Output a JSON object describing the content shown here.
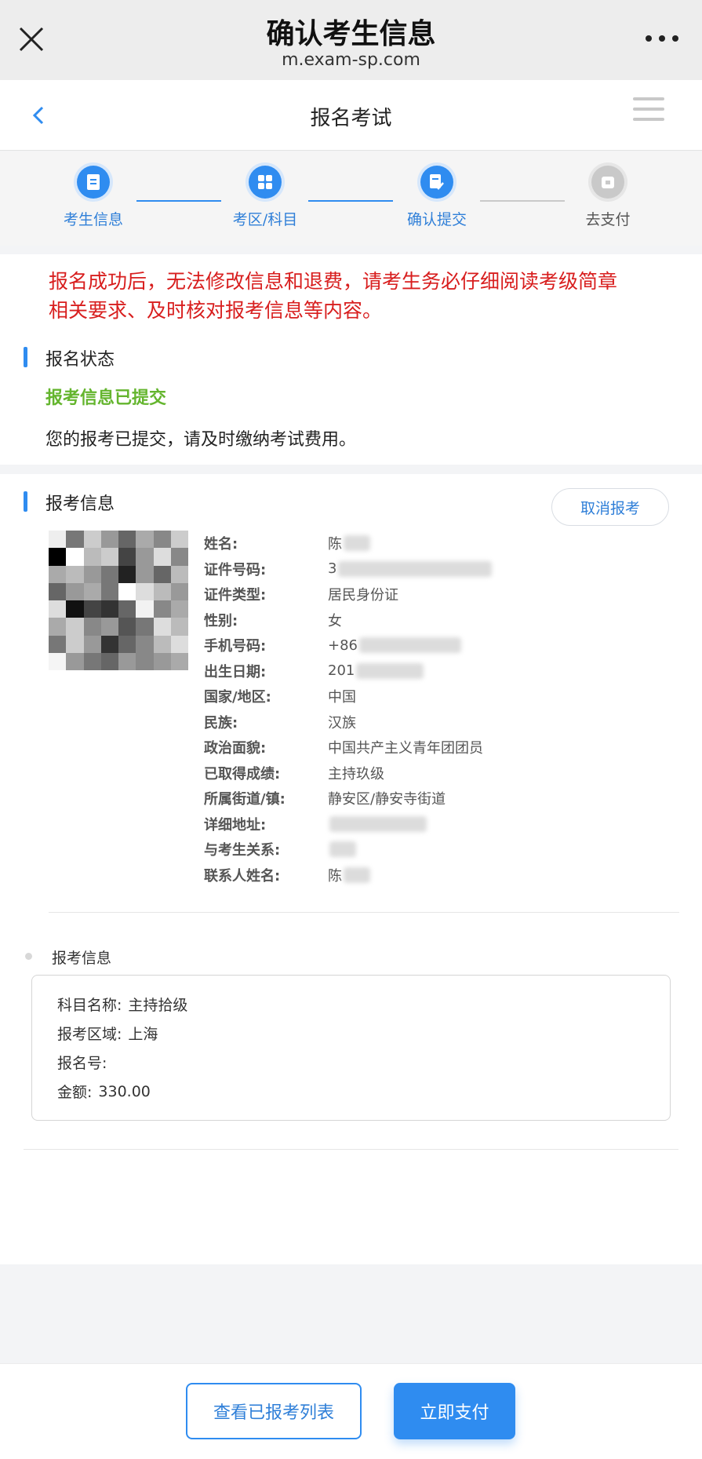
{
  "browser": {
    "title": "确认考生信息",
    "url": "m.exam-sp.com",
    "close_icon": "close-icon",
    "more_icon": "more-icon"
  },
  "nav": {
    "title": "报名考试",
    "back_icon": "chevron-left-icon",
    "menu_icon": "menu-icon"
  },
  "steps": [
    {
      "label": "考生信息",
      "state": "done",
      "icon": "document-icon"
    },
    {
      "label": "考区/科目",
      "state": "done",
      "icon": "grid-icon"
    },
    {
      "label": "确认提交",
      "state": "current",
      "icon": "edit-document-icon"
    },
    {
      "label": "去支付",
      "state": "pending",
      "icon": "wallet-icon"
    }
  ],
  "notice": {
    "warning_line1": "报名成功后，无法修改信息和退费，请考生务必仔细阅读考级简章",
    "warning_line2": "相关要求、及时核对报考信息等内容。"
  },
  "status": {
    "section_title": "报名状态",
    "state": "报考信息已提交",
    "message": "您的报考已提交，请及时缴纳考试费用。"
  },
  "info": {
    "section_title": "报考信息",
    "cancel_label": "取消报考",
    "fields": [
      {
        "label": "姓名:",
        "value": "陈",
        "blurred": true
      },
      {
        "label": "证件号码:",
        "value": "3",
        "blurred": true
      },
      {
        "label": "证件类型:",
        "value": "居民身份证",
        "blurred": false
      },
      {
        "label": "性别:",
        "value": "女",
        "blurred": false
      },
      {
        "label": "手机号码:",
        "value": "+86",
        "blurred": true
      },
      {
        "label": "出生日期:",
        "value": "201",
        "blurred": true
      },
      {
        "label": "国家/地区:",
        "value": "中国",
        "blurred": false
      },
      {
        "label": "民族:",
        "value": "汉族",
        "blurred": false
      },
      {
        "label": "政治面貌:",
        "value": "中国共产主义青年团团员",
        "blurred": false
      },
      {
        "label": "已取得成绩:",
        "value": "主持玖级",
        "blurred": false
      },
      {
        "label": "所属街道/镇:",
        "value": "静安区/静安寺街道",
        "blurred": false
      },
      {
        "label": "详细地址:",
        "value": "",
        "blurred": true
      },
      {
        "label": "与考生关系:",
        "value": "",
        "blurred": true
      },
      {
        "label": "联系人姓名:",
        "value": "陈",
        "blurred": true
      }
    ]
  },
  "subject": {
    "title": "报考信息",
    "name_label": "科目名称:",
    "name_value": "主持拾级",
    "area_label": "报考区域:",
    "area_value": "上海",
    "number_label": "报名号:",
    "number_value": "",
    "amount_label": "金额:",
    "amount_value": "330.00"
  },
  "actions": {
    "view_list": "查看已报考列表",
    "pay_now": "立即支付"
  },
  "colors": {
    "accent": "#2f8cf0",
    "warning": "#d81e1e",
    "success": "#64b52e"
  }
}
